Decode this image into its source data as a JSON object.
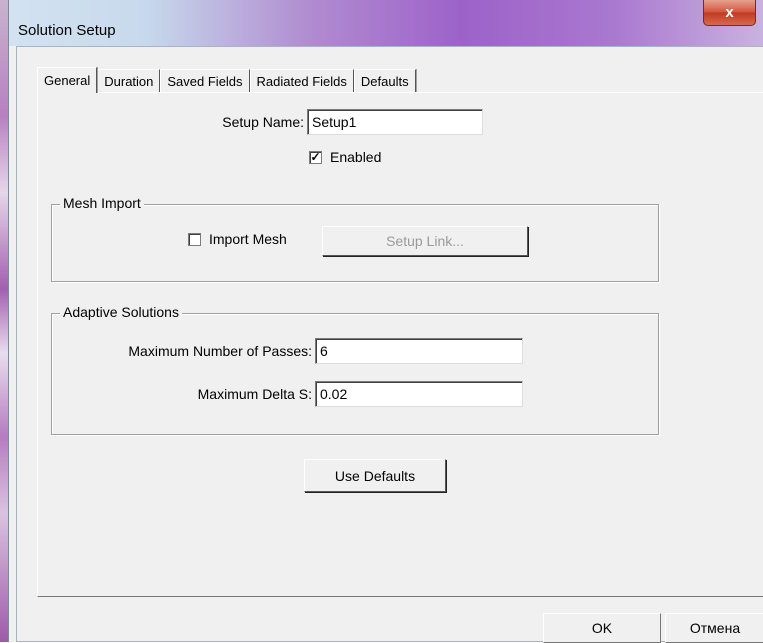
{
  "window": {
    "title": "Solution Setup",
    "close_glyph": "x"
  },
  "tabs": [
    {
      "label": "General",
      "active": true
    },
    {
      "label": "Duration"
    },
    {
      "label": "Saved Fields"
    },
    {
      "label": "Radiated Fields"
    },
    {
      "label": "Defaults"
    }
  ],
  "general": {
    "setup_name_label": "Setup Name:",
    "setup_name_value": "Setup1",
    "enabled_label": "Enabled",
    "enabled_checked": true,
    "mesh_import": {
      "group_label": "Mesh Import",
      "import_mesh_label": "Import Mesh",
      "import_mesh_checked": false,
      "setup_link_label": "Setup Link..."
    },
    "adaptive": {
      "group_label": "Adaptive Solutions",
      "max_passes_label": "Maximum Number of Passes:",
      "max_passes_value": "6",
      "max_delta_label": "Maximum Delta S:",
      "max_delta_value": "0.02"
    },
    "use_defaults_label": "Use Defaults"
  },
  "footer": {
    "ok_label": "OK",
    "cancel_label": "Отмена"
  }
}
